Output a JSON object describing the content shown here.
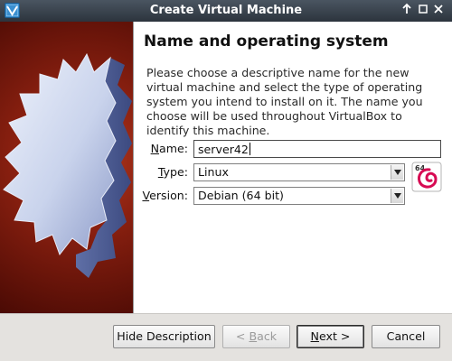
{
  "window": {
    "title": "Create Virtual Machine",
    "controls": {
      "pin": "🠕",
      "maximize": "□",
      "close": "✕"
    }
  },
  "page": {
    "heading": "Name and operating system",
    "description": "Please choose a descriptive name for the new virtual machine and select the type of operating system you intend to install on it. The name you choose will be used throughout VirtualBox to identify this machine."
  },
  "form": {
    "name": {
      "label_mnemonic": "N",
      "label_rest": "ame:",
      "value": "server42"
    },
    "type": {
      "label_mnemonic": "T",
      "label_rest": "ype:",
      "value": "Linux"
    },
    "version": {
      "label_mnemonic": "V",
      "label_rest": "ersion:",
      "value": "Debian (64 bit)"
    },
    "os_icon": {
      "badge": "64",
      "name": "debian-os-icon",
      "color": "#d70a53"
    }
  },
  "buttons": {
    "hide_description": "Hide Description",
    "back_prefix": "< ",
    "back_mnemonic": "B",
    "back_rest": "ack",
    "next_mnemonic": "N",
    "next_rest": "ext >",
    "cancel": "Cancel"
  },
  "colors": {
    "titlebar": "#2c343d",
    "art_background": "#8a2010",
    "art_shape": "#c8d4ee"
  }
}
